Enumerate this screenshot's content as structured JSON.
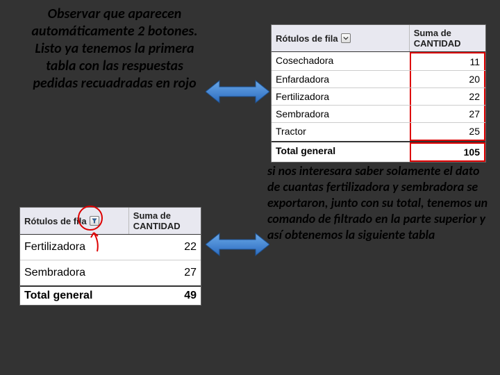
{
  "top_text": "Observar que aparecen automáticamente 2 botones.\nListo ya tenemos la primera tabla con las respuestas pedidas recuadradas en rojo",
  "right_text": "si nos interesara saber solamente el dato de cuantas fertilizadora y sembradora se exportaron, junto con su total, tenemos un comando de filtrado en la parte superior y así obtenemos la siguiente tabla",
  "pivot_large": {
    "header_rotulos": "Rótulos de fila",
    "header_suma": "Suma de CANTIDAD",
    "rows": [
      {
        "label": "Cosechadora",
        "value": "11"
      },
      {
        "label": "Enfardadora",
        "value": "20"
      },
      {
        "label": "Fertilizadora",
        "value": "22"
      },
      {
        "label": "Sembradora",
        "value": "27"
      },
      {
        "label": "Tractor",
        "value": "25"
      }
    ],
    "total_label": "Total general",
    "total_value": "105"
  },
  "pivot_small": {
    "header_rotulos": "Rótulos de fila",
    "header_suma": "Suma de CANTIDAD",
    "rows": [
      {
        "label": "Fertilizadora",
        "value": "22"
      },
      {
        "label": "Sembradora",
        "value": "27"
      }
    ],
    "total_label": "Total general",
    "total_value": "49"
  }
}
